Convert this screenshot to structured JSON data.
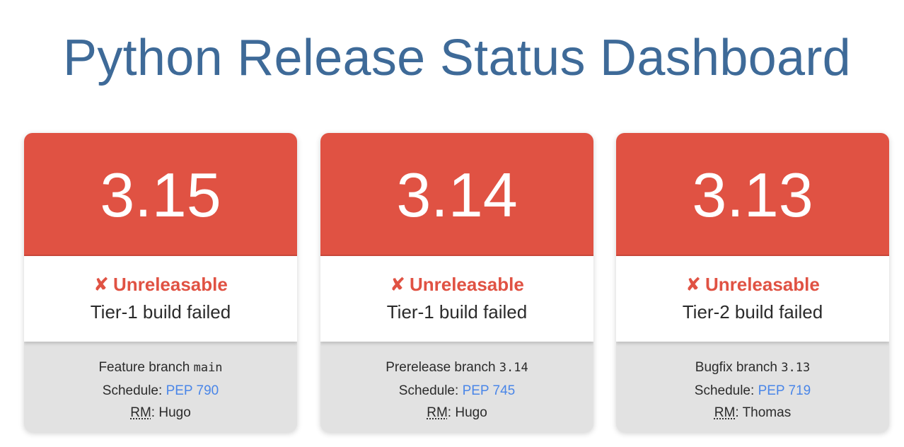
{
  "page": {
    "title": "Python Release Status Dashboard"
  },
  "colors": {
    "title": "#3e6a98",
    "card_header": "#e05243",
    "status_text": "#e05243",
    "link": "#4a86e8",
    "info_background": "#e2e2e2"
  },
  "cards": [
    {
      "version": "3.15",
      "status_icon": "✘",
      "status_label": "Unreleasable",
      "status_detail": "Tier-1 build failed",
      "branch_prefix": "Feature branch",
      "branch_name": "main",
      "schedule_label": "Schedule:",
      "pep_link": "PEP 790",
      "rm_label": "RM",
      "rm_name": "Hugo"
    },
    {
      "version": "3.14",
      "status_icon": "✘",
      "status_label": "Unreleasable",
      "status_detail": "Tier-1 build failed",
      "branch_prefix": "Prerelease branch",
      "branch_name": "3.14",
      "schedule_label": "Schedule:",
      "pep_link": "PEP 745",
      "rm_label": "RM",
      "rm_name": "Hugo"
    },
    {
      "version": "3.13",
      "status_icon": "✘",
      "status_label": "Unreleasable",
      "status_detail": "Tier-2 build failed",
      "branch_prefix": "Bugfix branch",
      "branch_name": "3.13",
      "schedule_label": "Schedule:",
      "pep_link": "PEP 719",
      "rm_label": "RM",
      "rm_name": "Thomas"
    }
  ]
}
